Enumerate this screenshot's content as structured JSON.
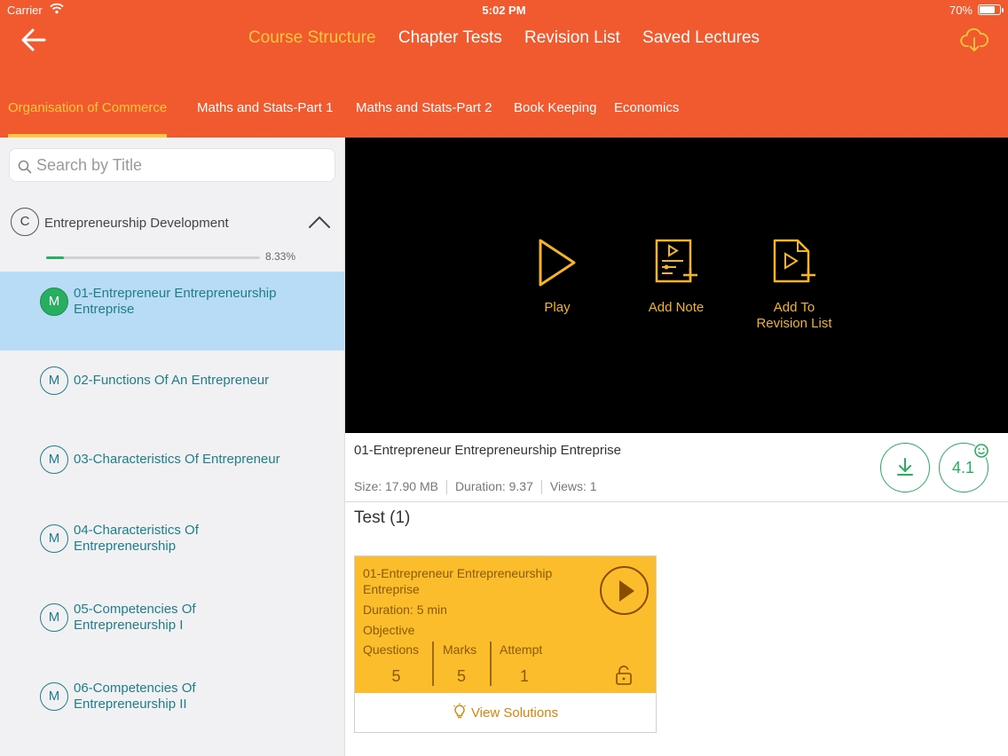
{
  "status_bar": {
    "carrier": "Carrier",
    "time": "5:02 PM",
    "battery": "70%",
    "battery_level": 0.7
  },
  "header": {
    "nav": [
      "Course Structure",
      "Chapter Tests",
      "Revision List",
      "Saved Lectures"
    ],
    "active_nav": "Course Structure",
    "subject_tabs": [
      "Organisation of Commerce",
      "Maths and Stats-Part 1",
      "Maths and Stats-Part 2",
      "Book Keeping",
      "Economics"
    ],
    "active_subject": "Organisation of Commerce"
  },
  "sidebar": {
    "search_placeholder": "Search by Title",
    "chapter": {
      "badge": "C",
      "title": "Entrepreneurship Development",
      "progress_label": "8.33%",
      "progress": 0.0833
    },
    "lectures": [
      {
        "badge": "M",
        "title": "01-Entrepreneur Entrepreneurship Entreprise",
        "active": true
      },
      {
        "badge": "M",
        "title": "02-Functions Of An Entrepreneur",
        "active": false
      },
      {
        "badge": "M",
        "title": "03-Characteristics Of Entrepreneur",
        "active": false
      },
      {
        "badge": "M",
        "title": "04-Characteristics Of Entrepreneurship",
        "active": false
      },
      {
        "badge": "M",
        "title": "05-Competencies Of Entrepreneurship I",
        "active": false
      },
      {
        "badge": "M",
        "title": "06-Competencies Of Entrepreneurship II",
        "active": false
      }
    ]
  },
  "player": {
    "play_label": "Play",
    "add_note_label": "Add Note",
    "add_revision_label_1": "Add To",
    "add_revision_label_2": "Revision List"
  },
  "video_info": {
    "title": "01-Entrepreneur Entrepreneurship Entreprise",
    "size": "Size: 17.90 MB",
    "duration": "Duration: 9.37",
    "views": "Views: 1",
    "rating": "4.1"
  },
  "tests": {
    "heading": "Test (1)",
    "card": {
      "title": "01-Entrepreneur Entrepreneurship Entreprise",
      "duration": "Duration:  5 min",
      "type": "Objective",
      "questions_label": "Questions",
      "questions": "5",
      "marks_label": "Marks",
      "marks": "5",
      "attempt_label": "Attempt",
      "attempt": "1",
      "view_solutions": "View Solutions"
    }
  },
  "colors": {
    "header": "#f05a2e",
    "accent": "#ffc83d",
    "teal": "#1f7d8a",
    "green": "#27ae60",
    "gold": "#f4b424",
    "card": "#fbbd2c"
  }
}
